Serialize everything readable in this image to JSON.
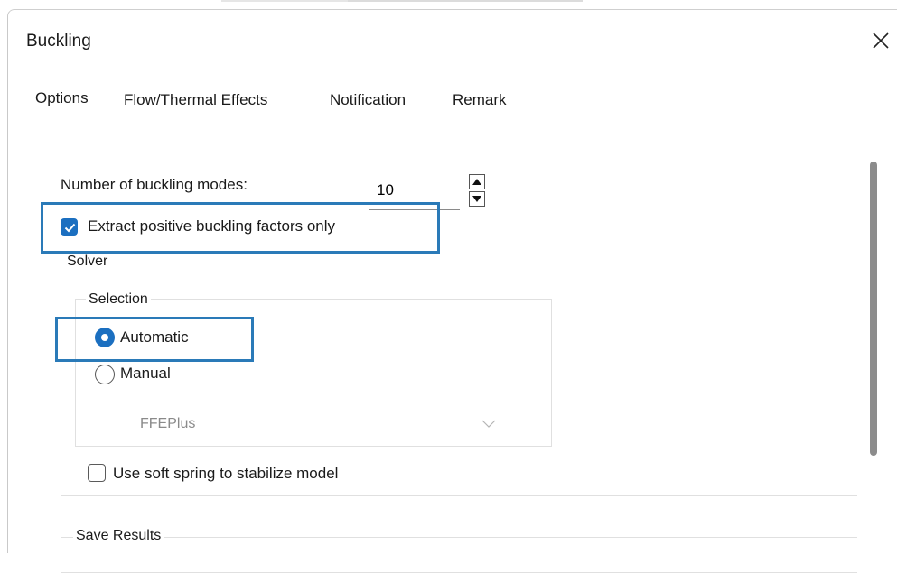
{
  "window": {
    "title": "Buckling",
    "close_icon": "close-icon"
  },
  "tabs": [
    {
      "label": "Options"
    },
    {
      "label": "Flow/Thermal Effects"
    },
    {
      "label": "Notification"
    },
    {
      "label": "Remark"
    }
  ],
  "options": {
    "buckling_modes_label": "Number of buckling modes:",
    "buckling_modes_value": "10",
    "extract_positive_label": "Extract positive buckling factors only",
    "extract_positive_checked": true
  },
  "solver": {
    "group_label": "Solver",
    "selection_label": "Selection",
    "automatic_label": "Automatic",
    "manual_label": "Manual",
    "selected": "Automatic",
    "solver_value": "FFEPlus",
    "soft_spring_label": "Use soft spring to stabilize model",
    "soft_spring_checked": false
  },
  "save_results": {
    "group_label": "Save Results"
  },
  "colors": {
    "accent": "#1b6fc0",
    "highlight": "#2a7ab8",
    "disabled_text": "#8a8a8a"
  }
}
